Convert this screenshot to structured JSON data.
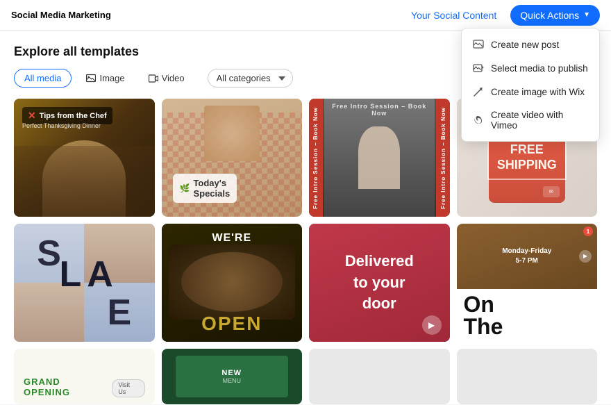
{
  "header": {
    "logo": "Social Media Marketing",
    "social_content_btn": "Your Social Content",
    "quick_actions_btn": "Quick Actions"
  },
  "dropdown": {
    "items": [
      {
        "id": "create-post",
        "label": "Create new post",
        "icon": "image-icon"
      },
      {
        "id": "select-media",
        "label": "Select media to publish",
        "icon": "photo-icon"
      },
      {
        "id": "create-image",
        "label": "Create image with Wix",
        "icon": "wand-icon"
      },
      {
        "id": "create-video",
        "label": "Create video with Vimeo",
        "icon": "vimeo-icon"
      }
    ]
  },
  "explore": {
    "title": "Explore all templates",
    "filters": {
      "all_media": "All media",
      "image": "Image",
      "video": "Video",
      "all_categories": "All categories"
    }
  },
  "cards": [
    {
      "id": "tips-chef",
      "title": "Tips from the Chef",
      "subtitle": "Perfect Thanksgiving Dinner"
    },
    {
      "id": "todays-specials",
      "title": "Today's Specials"
    },
    {
      "id": "free-intro-session",
      "title": "Free Intro Session – Book Now"
    },
    {
      "id": "free-shipping",
      "title": "FREE SHIPPING"
    },
    {
      "id": "sale",
      "title": "SALE"
    },
    {
      "id": "were-open",
      "title": "WE'RE OPEN"
    },
    {
      "id": "delivered-door",
      "title": "Delivered to your door"
    },
    {
      "id": "on-the",
      "title": "On The"
    },
    {
      "id": "grand-opening",
      "title": "GRAND OPENING"
    },
    {
      "id": "new-menu",
      "title": "NEW MENU"
    }
  ],
  "colors": {
    "accent": "#116dff",
    "red": "#c0392b",
    "green": "#2a8a2a",
    "dark": "#1a1a1a"
  }
}
